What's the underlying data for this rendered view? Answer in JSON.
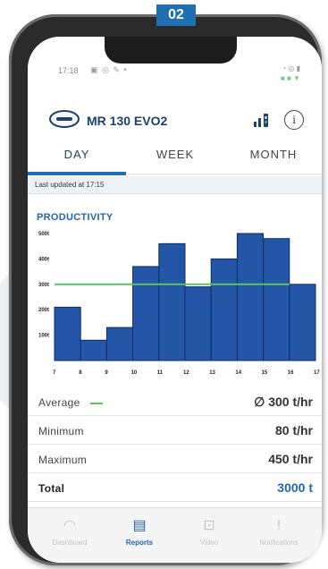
{
  "step_badge": "02",
  "status": {
    "time": "17:18",
    "left_icons": "▣ ◎ ✎ •",
    "right_top": "◔ ◎ ▮",
    "right_bottom": "■ ■ ▼"
  },
  "header": {
    "device_name": "MR 130 EVO2",
    "info_icon_glyph": "i"
  },
  "tabs": [
    {
      "label": "DAY",
      "active": true
    },
    {
      "label": "WEEK",
      "active": false
    },
    {
      "label": "MONTH",
      "active": false
    }
  ],
  "updated_text": "Last updated at 17:15",
  "productivity_title": "PRODUCTIVITY",
  "chart_data": {
    "type": "bar",
    "categories": [
      "7",
      "8",
      "9",
      "10",
      "11",
      "12",
      "13",
      "14",
      "15",
      "16",
      "17"
    ],
    "values": [
      210,
      80,
      130,
      370,
      460,
      290,
      400,
      500,
      480,
      300,
      0
    ],
    "average": 300,
    "ylim": [
      0,
      500
    ],
    "y_ticks": [
      "100t",
      "200t",
      "300t",
      "400t",
      "500t"
    ],
    "y_tick_values": [
      100,
      200,
      300,
      400,
      500
    ],
    "colors": {
      "bar": "#2356a6",
      "bar_border": "#0f2c66",
      "average": "#5cc35e"
    }
  },
  "stats": [
    {
      "label": "Average",
      "value": "∅ 300 t/hr"
    },
    {
      "label": "Minimum",
      "value": "80 t/hr"
    },
    {
      "label": "Maximum",
      "value": "450 t/hr"
    },
    {
      "label": "Total",
      "value": "3000 t"
    }
  ],
  "nav": [
    {
      "label": "Dashboard",
      "icon": "◠"
    },
    {
      "label": "Reports",
      "icon": "▤"
    },
    {
      "label": "Video",
      "icon": "⊡"
    },
    {
      "label": "Notifications",
      "icon": "!"
    }
  ]
}
